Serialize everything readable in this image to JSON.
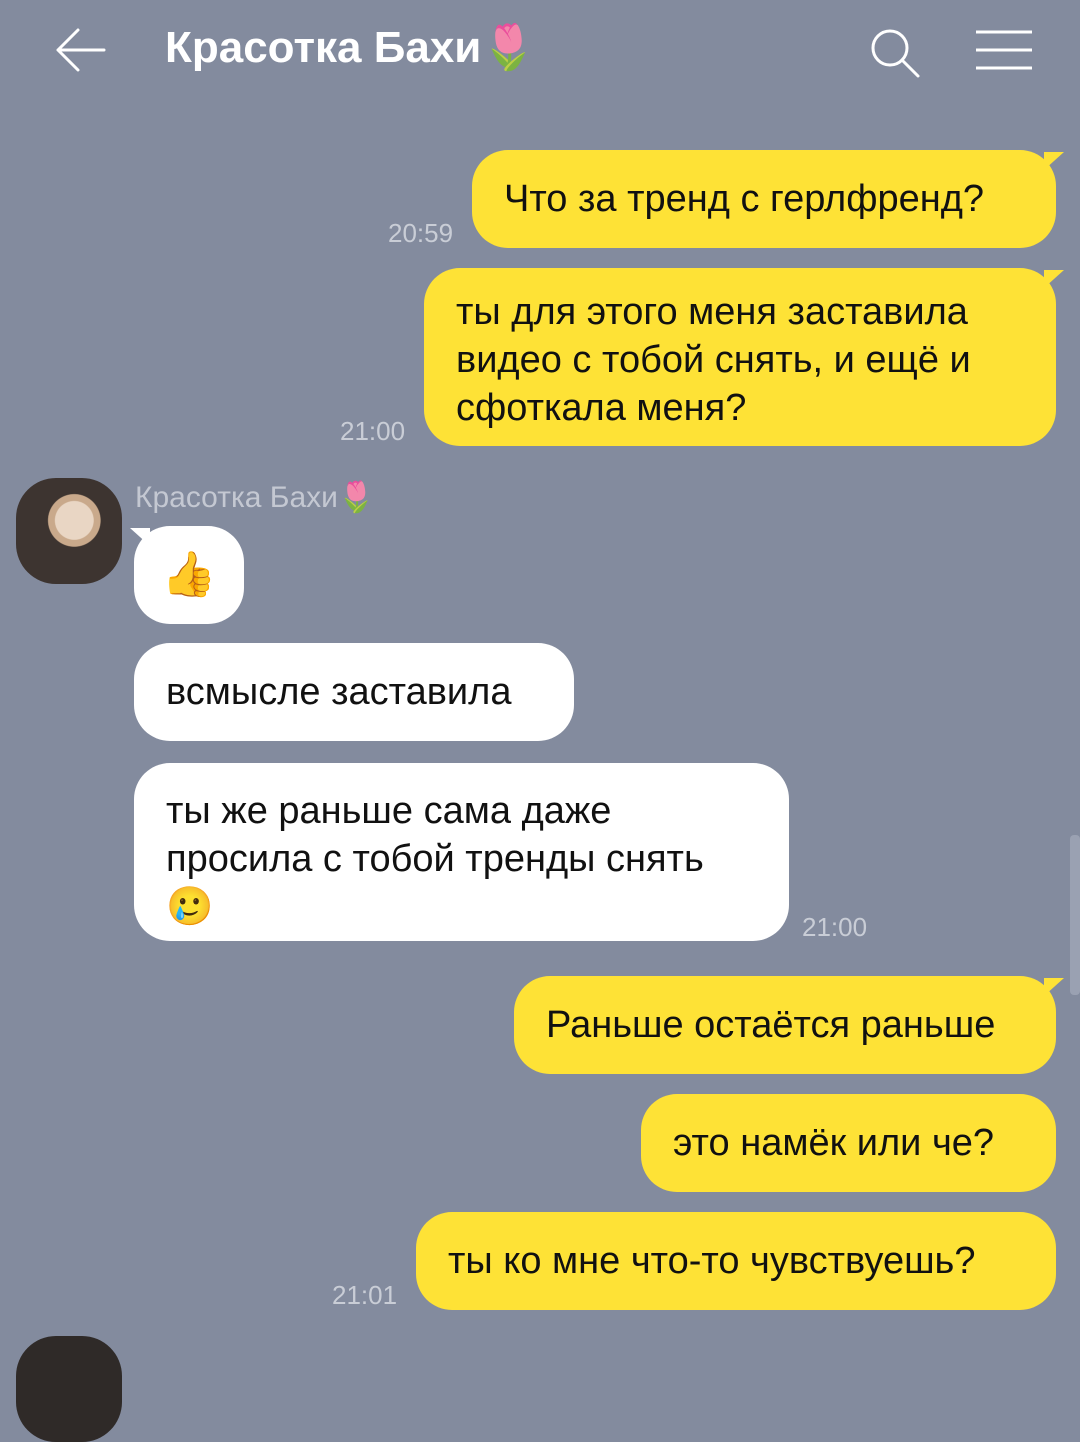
{
  "header": {
    "title": "Красотка Бахи🌷"
  },
  "contact_name": "Красотка Бахи🌷",
  "messages": [
    {
      "text": "Что за тренд с герлфренд?",
      "time": "20:59"
    },
    {
      "text": "ты для этого меня заставила видео с тобой снять, и ещё и сфоткала меня?",
      "time": "21:00"
    },
    {
      "text": "👍"
    },
    {
      "text": "всмысле заставила"
    },
    {
      "text": "ты же раньше сама даже просила с тобой тренды снять 🥲",
      "time": "21:00"
    },
    {
      "text": "Раньше остаётся раньше"
    },
    {
      "text": "это намёк или че?"
    },
    {
      "text": "ты ко мне что-то чувствуешь?",
      "time": "21:01"
    }
  ],
  "colors": {
    "background": "#838b9e",
    "my_bubble": "#fee236",
    "their_bubble": "#ffffff"
  }
}
